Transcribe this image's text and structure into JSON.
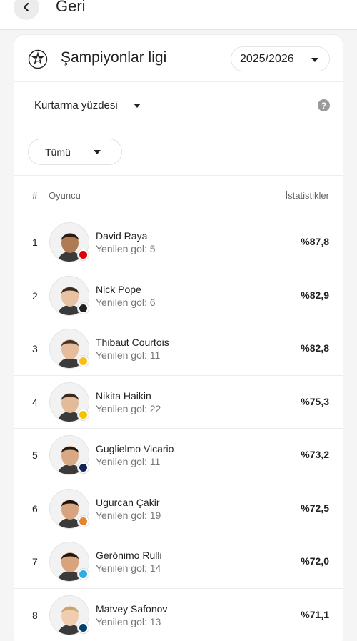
{
  "header": {
    "back_label": "Geri"
  },
  "competition": {
    "name": "Şampiyonlar ligi",
    "season": "2025/2026"
  },
  "metric": {
    "label": "Kurtarma yüzdesi",
    "help": "?"
  },
  "filter": {
    "label": "Tümü"
  },
  "table": {
    "col_rank": "#",
    "col_player": "Oyuncu",
    "col_stat": "İstatistikler",
    "rows": [
      {
        "rank": "1",
        "name": "David Raya",
        "sub": "Yenilen gol: 5",
        "value": "%87,8",
        "club_color": "#db0007",
        "skin": "#b07a55",
        "hair": "#2a1a12"
      },
      {
        "rank": "2",
        "name": "Nick Pope",
        "sub": "Yenilen gol: 6",
        "value": "%82,9",
        "club_color": "#241f20",
        "skin": "#e7c2a3",
        "hair": "#3b2a1e"
      },
      {
        "rank": "3",
        "name": "Thibaut Courtois",
        "sub": "Yenilen gol: 11",
        "value": "%82,8",
        "club_color": "#febe10",
        "skin": "#e5bd9c",
        "hair": "#4a3322"
      },
      {
        "rank": "4",
        "name": "Nikita Haikin",
        "sub": "Yenilen gol: 22",
        "value": "%75,3",
        "club_color": "#f2c500",
        "skin": "#e3bb98",
        "hair": "#3a2a1e"
      },
      {
        "rank": "5",
        "name": "Guglielmo Vicario",
        "sub": "Yenilen gol: 11",
        "value": "%73,2",
        "club_color": "#132257",
        "skin": "#d9a985",
        "hair": "#241912"
      },
      {
        "rank": "6",
        "name": "Ugurcan Çakir",
        "sub": "Yenilen gol: 19",
        "value": "%72,5",
        "club_color": "#e6852c",
        "skin": "#d7a47f",
        "hair": "#1c1410"
      },
      {
        "rank": "7",
        "name": "Gerónimo Rulli",
        "sub": "Yenilen gol: 14",
        "value": "%72,0",
        "club_color": "#2faee0",
        "skin": "#d9a47c",
        "hair": "#20160f"
      },
      {
        "rank": "8",
        "name": "Matvey Safonov",
        "sub": "Yenilen gol: 13",
        "value": "%71,1",
        "club_color": "#004170",
        "skin": "#f0cdb1",
        "hair": "#c9a56f"
      }
    ]
  }
}
